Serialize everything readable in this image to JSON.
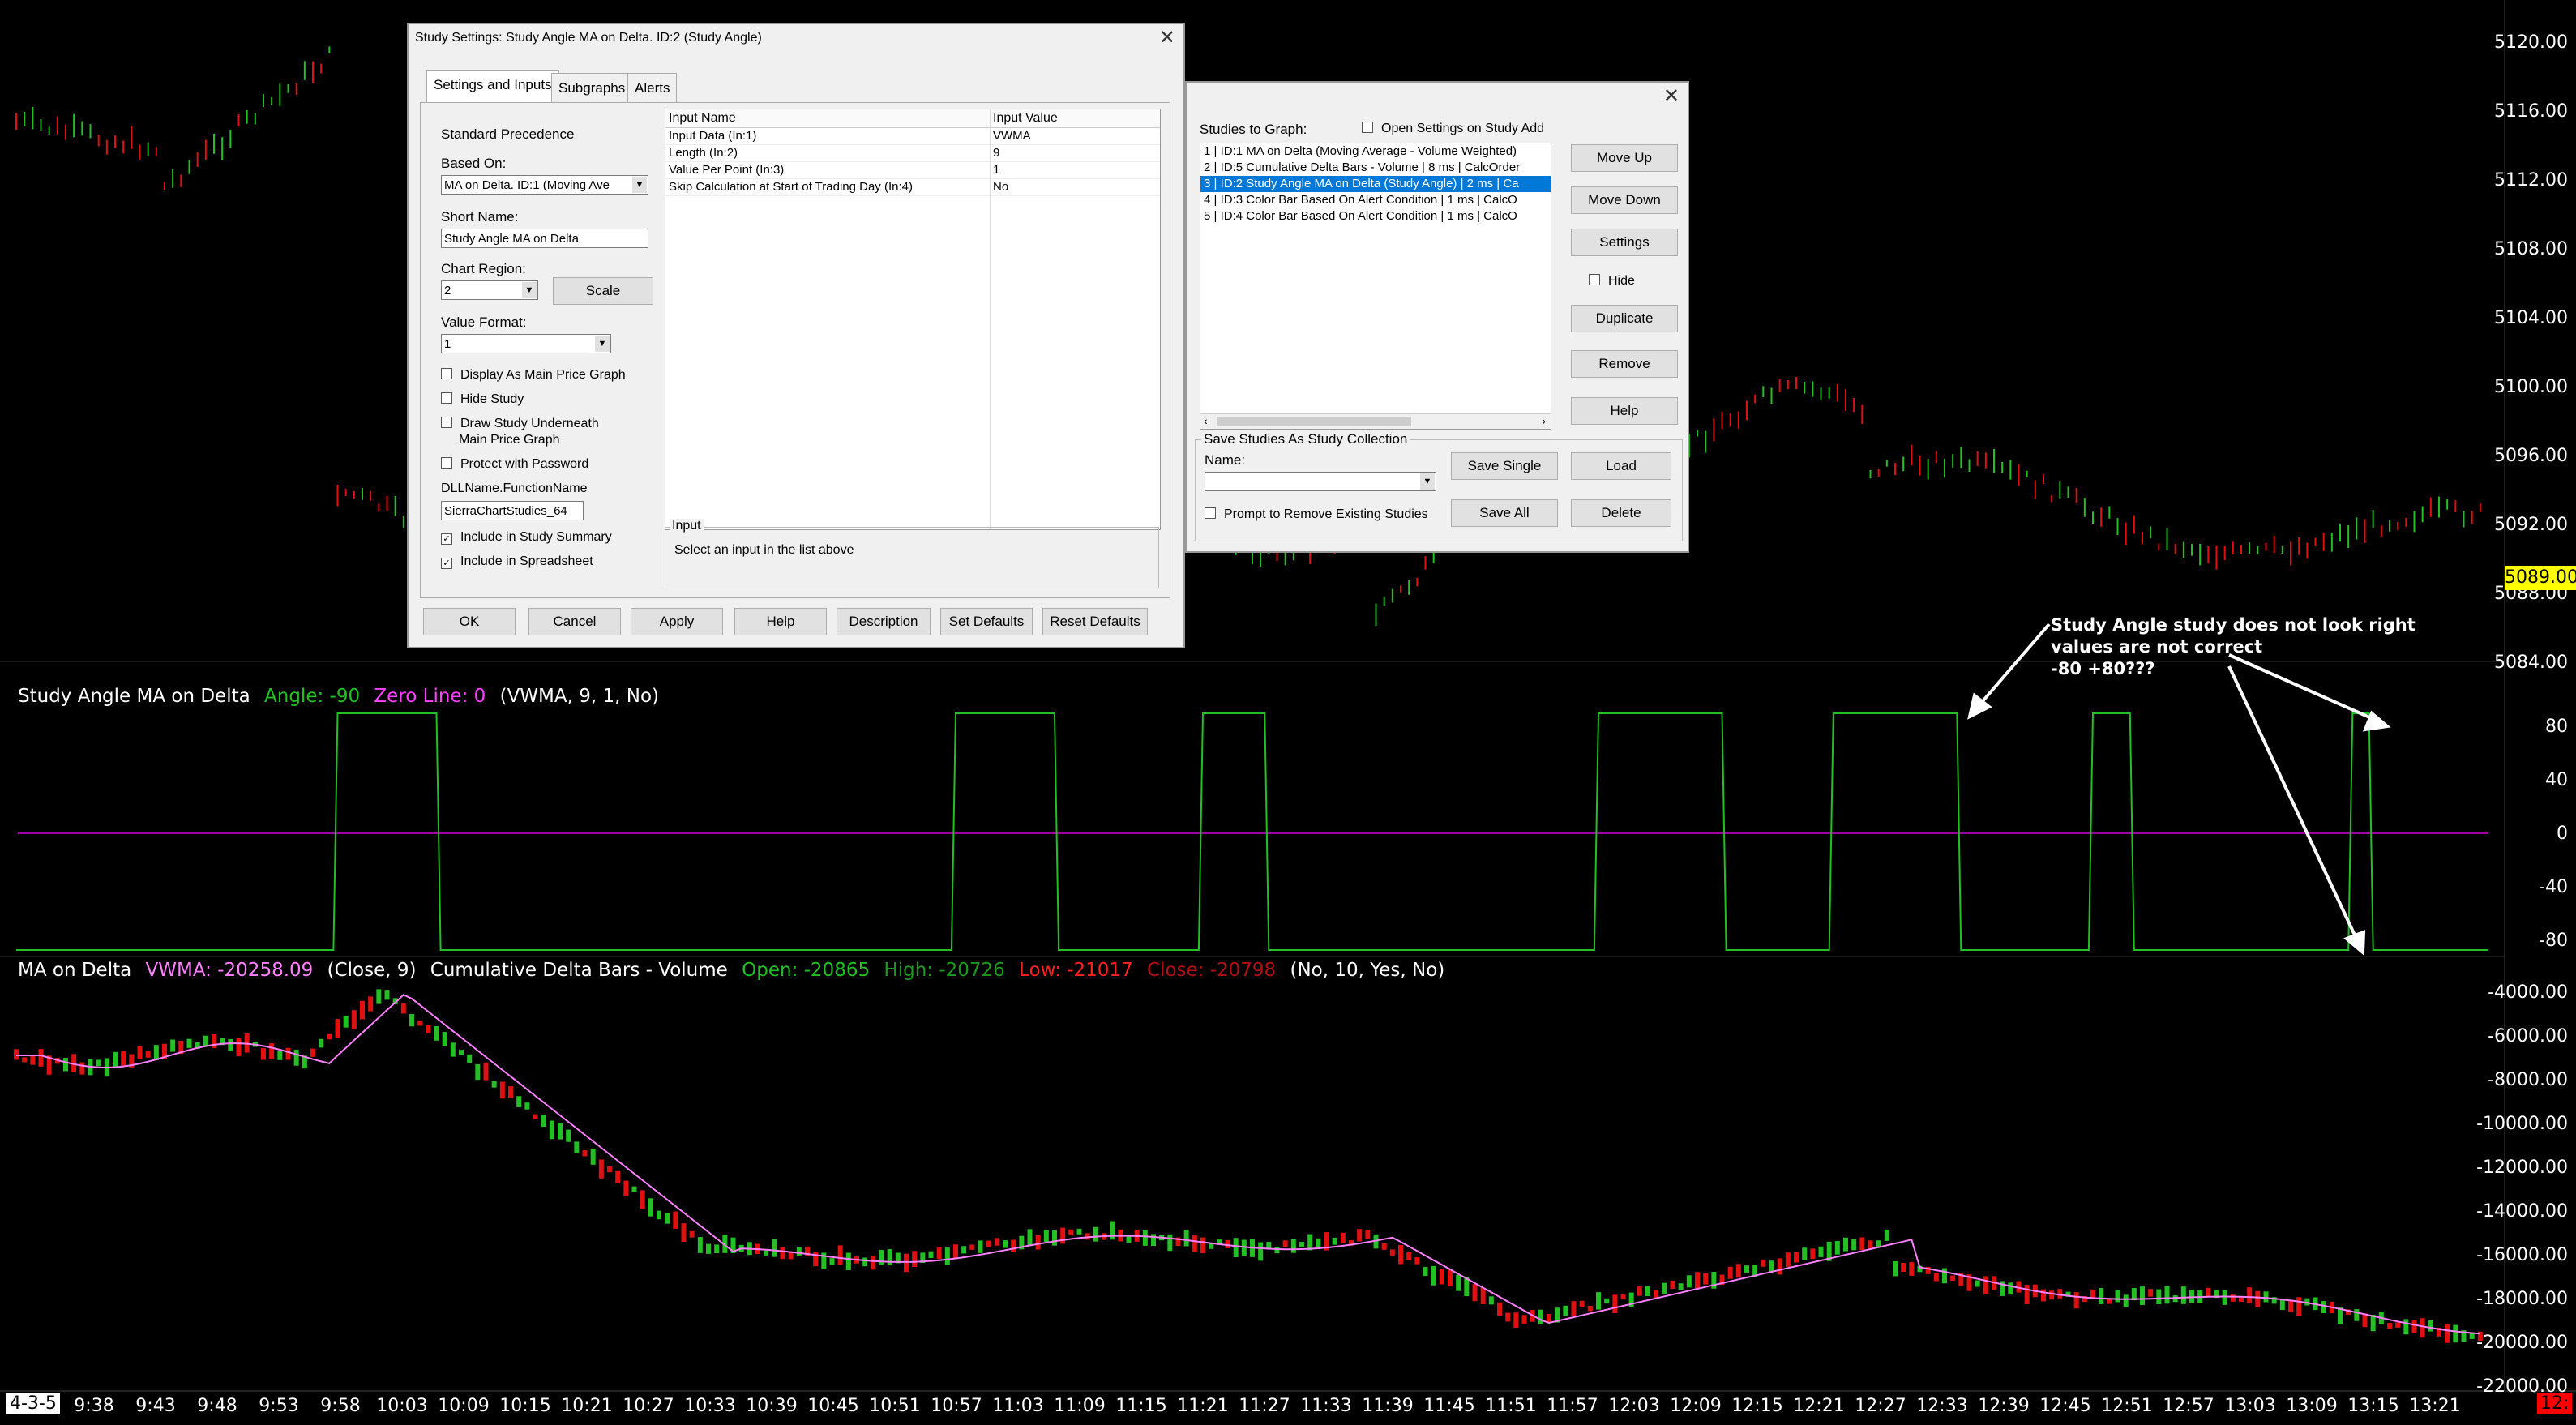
{
  "price_axis": {
    "labels": [
      "5120.00",
      "5116.00",
      "5112.00",
      "5108.00",
      "5104.00",
      "5100.00",
      "5096.00",
      "5092.00",
      "5088.00",
      "5084.00"
    ],
    "current_price": "5089.00",
    "current_price_color": "#ffff00"
  },
  "angle_axis": {
    "labels": [
      "80",
      "40",
      "0",
      "-40",
      "-80"
    ]
  },
  "delta_axis": {
    "labels": [
      "-4000.00",
      "-6000.00",
      "-8000.00",
      "-10000.00",
      "-12000.00",
      "-14000.00",
      "-16000.00",
      "-18000.00",
      "-20000.00",
      "-22000.00"
    ]
  },
  "time_axis": {
    "date": "4-3-5",
    "labels": [
      "9:38",
      "9:43",
      "9:48",
      "9:53",
      "9:58",
      "10:03",
      "10:09",
      "10:15",
      "10:21",
      "10:27",
      "10:33",
      "10:39",
      "10:45",
      "10:51",
      "10:57",
      "11:03",
      "11:09",
      "11:15",
      "11:21",
      "11:27",
      "11:33",
      "11:39",
      "11:45",
      "11:51",
      "11:57",
      "12:03",
      "12:09",
      "12:15",
      "12:21",
      "12:27",
      "12:33",
      "12:39",
      "12:45",
      "12:51",
      "12:57",
      "13:03",
      "13:09",
      "13:15",
      "13:21"
    ],
    "clock": "12:"
  },
  "angle_pane": {
    "title": "Study Angle MA on Delta",
    "angle_label": "Angle: -90",
    "zero_label": "Zero Line: 0",
    "params": "(VWMA, 9, 1, No)",
    "line_color": "#22c022",
    "zero_color": "#a000a0"
  },
  "delta_pane": {
    "ma_title": "MA on Delta",
    "vwma_label": "VWMA: -20258.09",
    "ma_params": "(Close, 9)",
    "bars_title": "Cumulative Delta Bars - Volume",
    "open_label": "Open: -20865",
    "high_label": "High: -20726",
    "low_label": "Low: -21017",
    "close_label": "Close: -20798",
    "bars_params": "(No, 10, Yes, No)"
  },
  "annotation": {
    "lines": [
      "Study Angle study does not look right",
      "values are not correct",
      "-80 +80???"
    ]
  },
  "study_settings": {
    "title": "Study Settings: Study Angle MA on Delta. ID:2 (Study Angle)",
    "tabs": [
      "Settings and Inputs",
      "Subgraphs",
      "Alerts"
    ],
    "standard_precedence": "Standard Precedence",
    "based_on_label": "Based On:",
    "based_on_value": "MA on Delta. ID:1 (Moving Ave",
    "short_name_label": "Short Name:",
    "short_name_value": "Study Angle MA on Delta",
    "chart_region_label": "Chart Region:",
    "chart_region_value": "2",
    "scale_button": "Scale",
    "value_format_label": "Value Format:",
    "value_format_value": "1",
    "checkboxes": [
      {
        "label": "Display As Main Price Graph",
        "checked": false
      },
      {
        "label": "Hide Study",
        "checked": false
      },
      {
        "label": "Draw Study Underneath",
        "checked": false
      },
      {
        "label": "Protect with Password",
        "checked": false
      }
    ],
    "draw_underneath_line2": "Main Price Graph",
    "dll_label": "DLLName.FunctionName",
    "dll_value": "SierraChartStudies_64",
    "include_summary": "Include in Study Summary",
    "include_spreadsheet": "Include in Spreadsheet",
    "grid_headers": [
      "Input Name",
      "Input Value"
    ],
    "inputs": [
      {
        "name": "Input Data   (In:1)",
        "value": "VWMA"
      },
      {
        "name": "Length   (In:2)",
        "value": "9"
      },
      {
        "name": "Value Per Point   (In:3)",
        "value": "1"
      },
      {
        "name": "Skip Calculation at Start of Trading Day   (In:4)",
        "value": "No"
      }
    ],
    "input_group_label": "Input",
    "input_hint": "Select an input in the list above",
    "buttons": [
      "OK",
      "Cancel",
      "Apply",
      "Help",
      "Description",
      "Set Defaults",
      "Reset Defaults"
    ]
  },
  "studies_dialog": {
    "studies_label": "Studies to Graph:",
    "open_settings": "Open Settings on Study Add",
    "studies": [
      "1 | ID:1  MA on Delta (Moving Average - Volume Weighted)",
      "2 | ID:5  Cumulative Delta Bars - Volume | 8 ms | CalcOrder",
      "3 | ID:2  Study Angle MA on Delta (Study Angle) | 2 ms | Ca",
      "4 | ID:3  Color Bar Based On Alert Condition | 1 ms | CalcO",
      "5 | ID:4  Color Bar Based On Alert Condition | 1 ms | CalcO"
    ],
    "selected_index": 2,
    "side_buttons": [
      "Move Up",
      "Move Down",
      "Settings"
    ],
    "hide_label": "Hide",
    "side_buttons2": [
      "Duplicate",
      "Remove",
      "Help"
    ],
    "save_group": "Save Studies As Study Collection",
    "name_label": "Name:",
    "save_single": "Save Single",
    "load": "Load",
    "prompt_remove": "Prompt to Remove Existing Studies",
    "save_all": "Save All",
    "delete": "Delete"
  }
}
